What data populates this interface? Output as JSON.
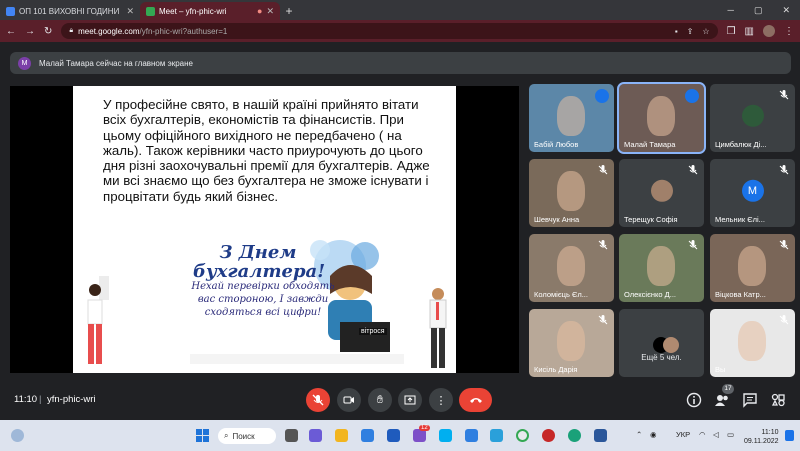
{
  "browser": {
    "tabs": [
      {
        "title": "ОП 101 ВИХОВНІ ГОДИНИ",
        "favicon_color": "#4285f4"
      },
      {
        "title": "Meet – yfn-phic-wri",
        "favicon_color": "#34a853"
      }
    ],
    "url_host": "meet.google.com",
    "url_path": "/yfn-phic-wri?authuser=1"
  },
  "banner": {
    "avatar_letter": "M",
    "text": "Малай Тамара сейчас на главном экране"
  },
  "slide": {
    "text": "У професійне свято, в нашій країні прийнято вітати всіх бухгалтерів, економістів та фінансистів. При цьому офіційного вихідного не передбачено ( на жаль). Також керівники часто приурочують до цього дня різні заохочувальні премії для бухгалтерів. Адже ми всі знаємо що без бухгалтера не зможе існувати і процвітати будь який бізнес.",
    "card_title": "З Днем бухгалтера!",
    "card_subtitle": "Нехай перевірки обходять вас стороною, І завжди сходяться всі цифри!",
    "card_brand": "вітрося"
  },
  "participants": [
    {
      "name": "Бабій Любов",
      "speaking": true,
      "bg": "#5c87a8"
    },
    {
      "name": "Малай Тамара",
      "speaking": true,
      "bg": "#6d5b55",
      "highlight": true
    },
    {
      "name": "Цимбалюк Ді...",
      "speaking": false,
      "bg": "#3c4043",
      "avatar_bg": "#2e5a3a"
    },
    {
      "name": "Шевчук Анна",
      "speaking": false,
      "bg": "#7a6a5a"
    },
    {
      "name": "Терещук Софія",
      "speaking": false,
      "bg": "#3c4043",
      "avatar_bg": "#a0806a"
    },
    {
      "name": "Мельник Єлі...",
      "speaking": false,
      "bg": "#3c4043",
      "letter": "M",
      "avatar_bg": "#1a73e8"
    },
    {
      "name": "Коломієць Єл...",
      "speaking": false,
      "bg": "#8a7a6a"
    },
    {
      "name": "Олексієнко Д...",
      "speaking": false,
      "bg": "#6a7a5a"
    },
    {
      "name": "Віцкова Катр...",
      "speaking": false,
      "bg": "#7a6658"
    },
    {
      "name": "Кисіль Дарія",
      "speaking": false,
      "bg": "#b8a898"
    },
    {
      "name": "Ещё 5 чел.",
      "speaking": false,
      "bg": "#3c4043",
      "more": true
    },
    {
      "name": "Вы",
      "speaking": false,
      "bg": "#e8e8e8"
    }
  ],
  "controls": {
    "time": "11:10",
    "meeting_code": "yfn-phic-wri",
    "participants_count": "17"
  },
  "taskbar": {
    "search_label": "Поиск",
    "lang": "УКР",
    "clock_time": "11:10",
    "clock_date": "09.11.2022",
    "viber_badge": "12"
  },
  "colors": {
    "accent": "#ea4335",
    "tab_active": "#5a1f2a",
    "speaking": "#1a73e8"
  }
}
